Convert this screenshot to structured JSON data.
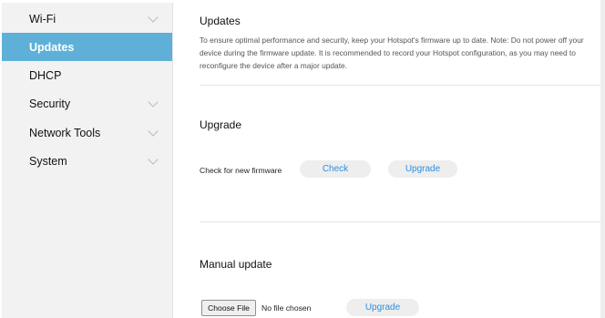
{
  "sidebar": {
    "items": [
      {
        "label": "Wi-Fi",
        "has_chevron": true,
        "active": false
      },
      {
        "label": "Updates",
        "has_chevron": false,
        "active": true
      },
      {
        "label": "DHCP",
        "has_chevron": false,
        "active": false
      },
      {
        "label": "Security",
        "has_chevron": true,
        "active": false
      },
      {
        "label": "Network Tools",
        "has_chevron": true,
        "active": false
      },
      {
        "label": "System",
        "has_chevron": true,
        "active": false
      }
    ],
    "active_color": "#5fb0d8"
  },
  "updates": {
    "title": "Updates",
    "description": "To ensure optimal performance and security, keep your Hotspot's firmware up to date. Note: Do not power off your device during the firmware update. It is recommended to record your Hotspot configuration, as you may need to reconfigure the device after a major update."
  },
  "upgrade": {
    "title": "Upgrade",
    "check_label": "Check for new firmware",
    "check_button": "Check",
    "upgrade_button": "Upgrade"
  },
  "manual": {
    "title": "Manual update",
    "choose_file_button": "Choose File",
    "file_status": "No file chosen",
    "upgrade_button": "Upgrade"
  },
  "icons": {
    "nav_chevron": "chevron-down-icon"
  },
  "colors": {
    "button_text": "#2a8fe0",
    "button_bg": "#eeeeee"
  }
}
